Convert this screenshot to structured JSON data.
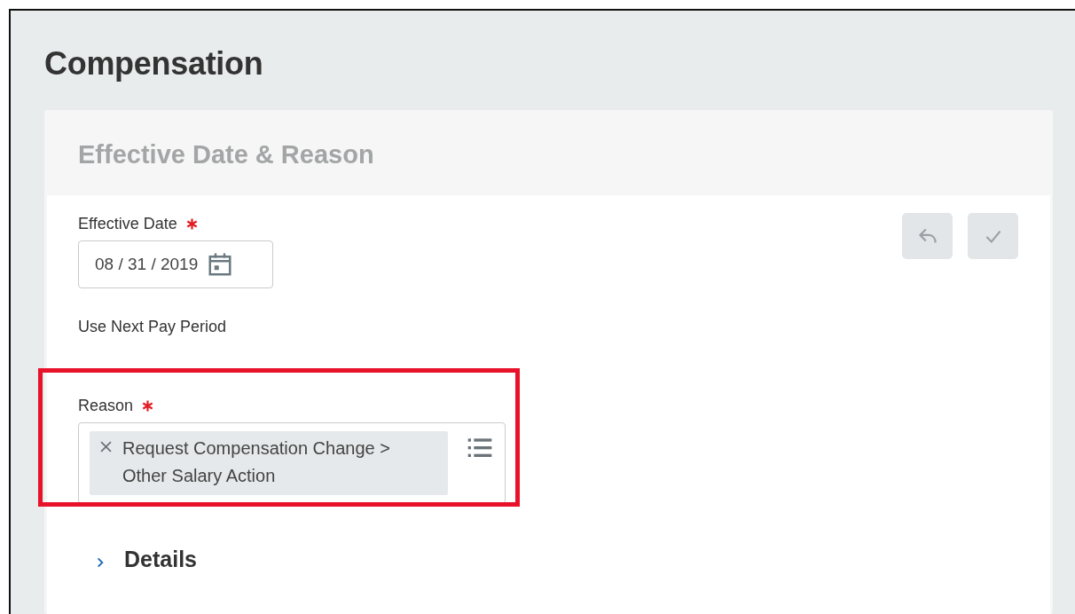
{
  "page": {
    "title": "Compensation"
  },
  "card": {
    "title": "Effective Date & Reason",
    "actions": [
      {
        "kind": "undo",
        "disabled": true
      },
      {
        "kind": "confirm",
        "disabled": true
      }
    ],
    "fields": [
      {
        "kind": "date",
        "label": "Effective Date",
        "required": true,
        "value": "08 / 31 / 2019"
      },
      {
        "kind": "text",
        "label": "Use Next Pay Period"
      },
      {
        "kind": "multiselect",
        "label": "Reason",
        "required": true,
        "highlighted": true,
        "values": [
          "Request Compensation Change > Other Salary Action"
        ]
      }
    ],
    "sections": [
      {
        "title": "Details",
        "expanded": false
      }
    ]
  }
}
